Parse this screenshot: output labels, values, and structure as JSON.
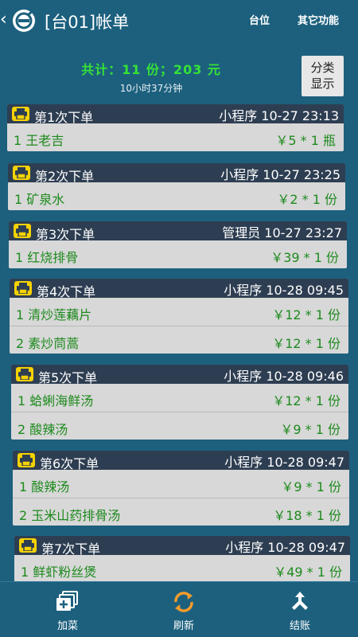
{
  "header": {
    "back_glyph": "‹",
    "title": "[台01]帐单",
    "table_btn": "台位",
    "more_btn": "其它功能"
  },
  "summary": {
    "total": "共计：11 份；203 元",
    "elapsed": "10小时37分钟",
    "classify_line1": "分类",
    "classify_line2": "显示"
  },
  "orders": [
    {
      "title": "第1次下单",
      "source": "小程序 10-27 23:13",
      "items": [
        {
          "name": "1 王老吉",
          "price": "￥5 * 1 瓶"
        }
      ]
    },
    {
      "title": "第2次下单",
      "source": "小程序 10-27 23:25",
      "items": [
        {
          "name": "1 矿泉水",
          "price": "￥2 * 1 份"
        }
      ]
    },
    {
      "title": "第3次下单",
      "source": "管理员 10-27 23:27",
      "items": [
        {
          "name": "1 红烧排骨",
          "price": "￥39 * 1 份"
        }
      ]
    },
    {
      "title": "第4次下单",
      "source": "小程序 10-28 09:45",
      "items": [
        {
          "name": "1 清炒莲藕片",
          "price": "￥12 * 1 份"
        },
        {
          "name": "2 素炒茼蒿",
          "price": "￥12 * 1 份"
        }
      ]
    },
    {
      "title": "第5次下单",
      "source": "小程序 10-28 09:46",
      "items": [
        {
          "name": "1 蛤蜊海鲜汤",
          "price": "￥12 * 1 份"
        },
        {
          "name": "2 酸辣汤",
          "price": "￥9 * 1 份"
        }
      ]
    },
    {
      "title": "第6次下单",
      "source": "小程序 10-28 09:47",
      "items": [
        {
          "name": "1 酸辣汤",
          "price": "￥9 * 1 份"
        },
        {
          "name": "2 玉米山药排骨汤",
          "price": "￥18 * 1 份"
        }
      ]
    },
    {
      "title": "第7次下单",
      "source": "小程序 10-28 09:47",
      "items": [
        {
          "name": "1 鲜虾粉丝煲",
          "price": "￥49 * 1 份"
        }
      ]
    }
  ],
  "tabs": {
    "add": "加菜",
    "refresh": "刷新",
    "checkout": "结账"
  },
  "colors": {
    "background": "#1c607e",
    "order_header": "#2e3e52",
    "item_text": "#1e8a1e",
    "total_text": "#36e236",
    "printer_badge": "#f5d200",
    "refresh_icon": "#f39c2c"
  }
}
